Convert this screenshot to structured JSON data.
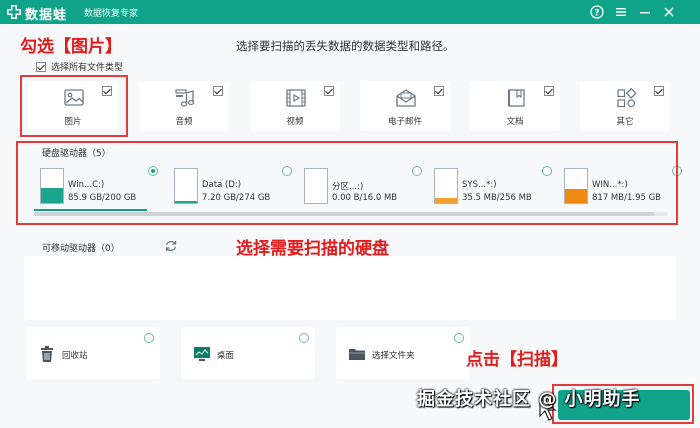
{
  "app": {
    "name": "数据蛙",
    "subtitle": "数据恢复专家"
  },
  "annotations": {
    "select_images": "勾选【图片】",
    "select_disk": "选择需要扫描的硬盘",
    "click_scan": "点击【扫描】"
  },
  "prompt": "选择要扫描的丢失数据的数据类型和路径。",
  "select_all": {
    "label": "选择所有文件类型",
    "checked": true
  },
  "file_types": [
    {
      "label": "图片",
      "icon": "image-icon",
      "checked": true
    },
    {
      "label": "音频",
      "icon": "music-icon",
      "checked": true
    },
    {
      "label": "视频",
      "icon": "video-icon",
      "checked": true
    },
    {
      "label": "电子邮件",
      "icon": "email-icon",
      "checked": true
    },
    {
      "label": "文档",
      "icon": "document-icon",
      "checked": true
    },
    {
      "label": "其它",
      "icon": "other-icon",
      "checked": true
    }
  ],
  "hard_drives": {
    "title": "硬盘驱动器（5）",
    "items": [
      {
        "name": "Win...C:)",
        "size": "85.9 GB/200 GB",
        "used_fraction": 0.43,
        "color": "#1aa58c",
        "selected": true
      },
      {
        "name": "Data (D:)",
        "size": "7.20 GB/274 GB",
        "used_fraction": 0.03,
        "color": "#1aa58c",
        "selected": false
      },
      {
        "name": "分区...:)",
        "size": "0.00  B/16.0 MB",
        "used_fraction": 0.0,
        "color": "#f0a030",
        "selected": false
      },
      {
        "name": "SYS...*:)",
        "size": "35.5 MB/256 MB",
        "used_fraction": 0.14,
        "color": "#f0a030",
        "selected": false
      },
      {
        "name": "WIN...*:)",
        "size": "817 MB/1.95 GB",
        "used_fraction": 0.41,
        "color": "#f08a10",
        "selected": false
      }
    ]
  },
  "removable": {
    "title": "可移动驱动器（0）"
  },
  "locations": [
    {
      "label": "回收站",
      "icon": "recycle-bin-icon"
    },
    {
      "label": "桌面",
      "icon": "desktop-icon"
    },
    {
      "label": "选择文件夹",
      "icon": "folder-icon"
    }
  ],
  "watermark": "掘金技术社区 @ 小明助手",
  "colors": {
    "brand": "#0fa48a",
    "annotation": "#e11d1d"
  }
}
